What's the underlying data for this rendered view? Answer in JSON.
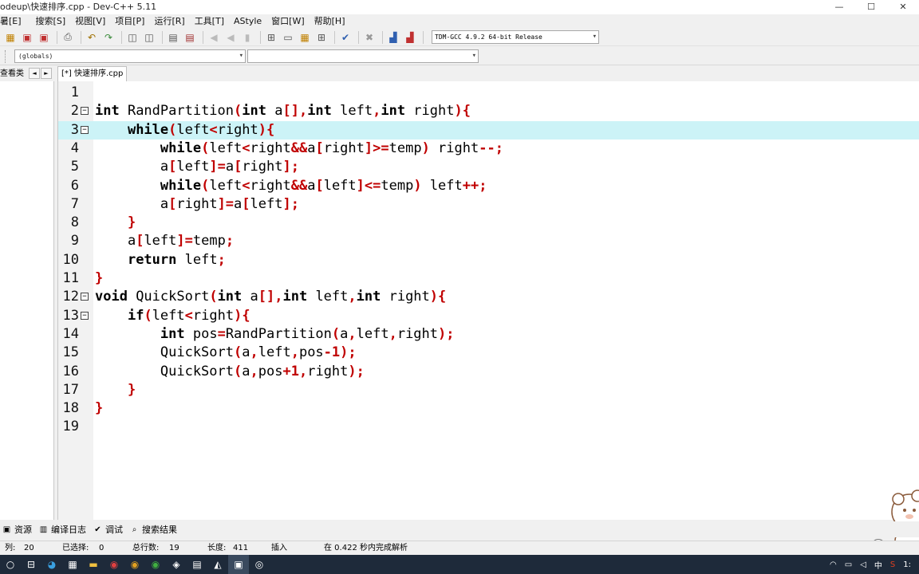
{
  "window": {
    "title": "odeup\\快速排序.cpp - Dev-C++ 5.11",
    "min": "—",
    "max": "☐",
    "close": "✕"
  },
  "menu": [
    "暑[E]",
    "搜索[S]",
    "视图[V]",
    "项目[P]",
    "运行[R]",
    "工具[T]",
    "AStyle",
    "窗口[W]",
    "帮助[H]"
  ],
  "toolbar": {
    "compiler": "TDM-GCC 4.9.2 64-bit Release"
  },
  "toolbar2": {
    "scope": "(globals)",
    "member": ""
  },
  "tabs": {
    "class_tab": "查看类",
    "file_tab": "[*] 快速排序.cpp",
    "prev": "◄",
    "next": "►"
  },
  "editor": {
    "current_line": 3,
    "lines": [
      {
        "n": "1",
        "fold": ""
      },
      {
        "n": "2",
        "fold": "⊟"
      },
      {
        "n": "3",
        "fold": "⊟"
      },
      {
        "n": "4",
        "fold": ""
      },
      {
        "n": "5",
        "fold": ""
      },
      {
        "n": "6",
        "fold": ""
      },
      {
        "n": "7",
        "fold": ""
      },
      {
        "n": "8",
        "fold": ""
      },
      {
        "n": "9",
        "fold": ""
      },
      {
        "n": "10",
        "fold": ""
      },
      {
        "n": "11",
        "fold": ""
      },
      {
        "n": "12",
        "fold": "⊟"
      },
      {
        "n": "13",
        "fold": "⊟"
      },
      {
        "n": "14",
        "fold": ""
      },
      {
        "n": "15",
        "fold": ""
      },
      {
        "n": "16",
        "fold": ""
      },
      {
        "n": "17",
        "fold": ""
      },
      {
        "n": "18",
        "fold": ""
      },
      {
        "n": "19",
        "fold": ""
      }
    ],
    "code": [
      [],
      [
        [
          "k",
          "int"
        ],
        [
          "p",
          " RandPartition"
        ],
        [
          "s",
          "("
        ],
        [
          "k",
          "int"
        ],
        [
          "p",
          " a"
        ],
        [
          "s",
          "[],"
        ],
        [
          "k",
          "int"
        ],
        [
          "p",
          " left"
        ],
        [
          "s",
          ","
        ],
        [
          "k",
          "int"
        ],
        [
          "p",
          " right"
        ],
        [
          "s",
          "){"
        ]
      ],
      [
        [
          "p",
          "    "
        ],
        [
          "k",
          "while"
        ],
        [
          "s",
          "("
        ],
        [
          "p",
          "left"
        ],
        [
          "s",
          "<"
        ],
        [
          "p",
          "right"
        ],
        [
          "s",
          ")"
        ],
        [
          "s",
          "{"
        ]
      ],
      [
        [
          "p",
          "        "
        ],
        [
          "k",
          "while"
        ],
        [
          "s",
          "("
        ],
        [
          "p",
          "left"
        ],
        [
          "s",
          "<"
        ],
        [
          "p",
          "right"
        ],
        [
          "s",
          "&&"
        ],
        [
          "p",
          "a"
        ],
        [
          "s",
          "["
        ],
        [
          "p",
          "right"
        ],
        [
          "s",
          "]>="
        ],
        [
          "p",
          "temp"
        ],
        [
          "s",
          ")"
        ],
        [
          "p",
          " right"
        ],
        [
          "s",
          "--;"
        ]
      ],
      [
        [
          "p",
          "        a"
        ],
        [
          "s",
          "["
        ],
        [
          "p",
          "left"
        ],
        [
          "s",
          "]="
        ],
        [
          "p",
          "a"
        ],
        [
          "s",
          "["
        ],
        [
          "p",
          "right"
        ],
        [
          "s",
          "];"
        ]
      ],
      [
        [
          "p",
          "        "
        ],
        [
          "k",
          "while"
        ],
        [
          "s",
          "("
        ],
        [
          "p",
          "left"
        ],
        [
          "s",
          "<"
        ],
        [
          "p",
          "right"
        ],
        [
          "s",
          "&&"
        ],
        [
          "p",
          "a"
        ],
        [
          "s",
          "["
        ],
        [
          "p",
          "left"
        ],
        [
          "s",
          "]<="
        ],
        [
          "p",
          "temp"
        ],
        [
          "s",
          ")"
        ],
        [
          "p",
          " left"
        ],
        [
          "s",
          "++;"
        ]
      ],
      [
        [
          "p",
          "        a"
        ],
        [
          "s",
          "["
        ],
        [
          "p",
          "right"
        ],
        [
          "s",
          "]="
        ],
        [
          "p",
          "a"
        ],
        [
          "s",
          "["
        ],
        [
          "p",
          "left"
        ],
        [
          "s",
          "];"
        ]
      ],
      [
        [
          "p",
          "    "
        ],
        [
          "s",
          "}"
        ]
      ],
      [
        [
          "p",
          "    a"
        ],
        [
          "s",
          "["
        ],
        [
          "p",
          "left"
        ],
        [
          "s",
          "]="
        ],
        [
          "p",
          "temp"
        ],
        [
          "s",
          ";"
        ]
      ],
      [
        [
          "p",
          "    "
        ],
        [
          "k",
          "return"
        ],
        [
          "p",
          " left"
        ],
        [
          "s",
          ";"
        ]
      ],
      [
        [
          "s",
          "}"
        ]
      ],
      [
        [
          "k",
          "void"
        ],
        [
          "p",
          " QuickSort"
        ],
        [
          "s",
          "("
        ],
        [
          "k",
          "int"
        ],
        [
          "p",
          " a"
        ],
        [
          "s",
          "[],"
        ],
        [
          "k",
          "int"
        ],
        [
          "p",
          " left"
        ],
        [
          "s",
          ","
        ],
        [
          "k",
          "int"
        ],
        [
          "p",
          " right"
        ],
        [
          "s",
          "){"
        ]
      ],
      [
        [
          "p",
          "    "
        ],
        [
          "k",
          "if"
        ],
        [
          "s",
          "("
        ],
        [
          "p",
          "left"
        ],
        [
          "s",
          "<"
        ],
        [
          "p",
          "right"
        ],
        [
          "s",
          "){"
        ]
      ],
      [
        [
          "p",
          "        "
        ],
        [
          "k",
          "int"
        ],
        [
          "p",
          " pos"
        ],
        [
          "s",
          "="
        ],
        [
          "p",
          "RandPartition"
        ],
        [
          "s",
          "("
        ],
        [
          "p",
          "a"
        ],
        [
          "s",
          ","
        ],
        [
          "p",
          "left"
        ],
        [
          "s",
          ","
        ],
        [
          "p",
          "right"
        ],
        [
          "s",
          ");"
        ]
      ],
      [
        [
          "p",
          "        QuickSort"
        ],
        [
          "s",
          "("
        ],
        [
          "p",
          "a"
        ],
        [
          "s",
          ","
        ],
        [
          "p",
          "left"
        ],
        [
          "s",
          ","
        ],
        [
          "p",
          "pos"
        ],
        [
          "s",
          "-"
        ],
        [
          "n",
          "1"
        ],
        [
          "s",
          ");"
        ]
      ],
      [
        [
          "p",
          "        QuickSort"
        ],
        [
          "s",
          "("
        ],
        [
          "p",
          "a"
        ],
        [
          "s",
          ","
        ],
        [
          "p",
          "pos"
        ],
        [
          "s",
          "+"
        ],
        [
          "n",
          "1"
        ],
        [
          "s",
          ","
        ],
        [
          "p",
          "right"
        ],
        [
          "s",
          ");"
        ]
      ],
      [
        [
          "p",
          "    "
        ],
        [
          "s",
          "}"
        ]
      ],
      [
        [
          "s",
          "}"
        ]
      ],
      []
    ]
  },
  "bottom_tabs": [
    {
      "icon": "resources-icon",
      "glyph": "▣",
      "label": "资源"
    },
    {
      "icon": "compile-log-icon",
      "glyph": "▥",
      "label": "编译日志"
    },
    {
      "icon": "debug-icon",
      "glyph": "✔",
      "label": "调试"
    },
    {
      "icon": "search-results-icon",
      "glyph": "⌕",
      "label": "搜索结果"
    }
  ],
  "status": {
    "col_label": "列:",
    "col": "20",
    "sel_label": "已选择:",
    "sel": "0",
    "lines_label": "总行数:",
    "lines": "19",
    "len_label": "长度:",
    "len": "411",
    "mode": "插入",
    "parse": "在 0.422 秒内完成解析"
  },
  "tray": {
    "ime": "中",
    "time": "1:"
  },
  "colors": {
    "keyword": "#000000",
    "symbol": "#c00000",
    "number": "#c00000",
    "current_line_bg": "#ccf3f7"
  }
}
